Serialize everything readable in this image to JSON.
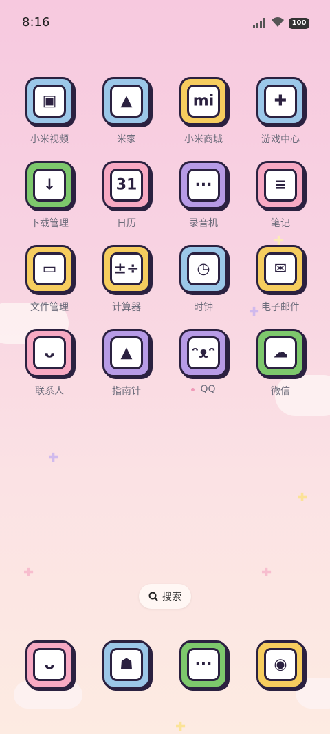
{
  "status_bar": {
    "time": "8:16",
    "battery": "100"
  },
  "apps": [
    {
      "label": "小米视频",
      "name": "app-xiaomi-video",
      "color": "#9bc7e8",
      "glyph": "▣"
    },
    {
      "label": "米家",
      "name": "app-mijia",
      "color": "#9bc7e8",
      "glyph": "▲"
    },
    {
      "label": "小米商城",
      "name": "app-xiaomi-mall",
      "color": "#f6cd5e",
      "glyph": "mi"
    },
    {
      "label": "游戏中心",
      "name": "app-game-center",
      "color": "#9bc7e8",
      "glyph": "✚"
    },
    {
      "label": "下载管理",
      "name": "app-downloads",
      "color": "#7dc86c",
      "glyph": "↓"
    },
    {
      "label": "日历",
      "name": "app-calendar",
      "color": "#f7a9c3",
      "glyph": "31"
    },
    {
      "label": "录音机",
      "name": "app-recorder",
      "color": "#b79be6",
      "glyph": "···"
    },
    {
      "label": "笔记",
      "name": "app-notes",
      "color": "#f7a9c3",
      "glyph": "≡"
    },
    {
      "label": "文件管理",
      "name": "app-file-manager",
      "color": "#f6cd5e",
      "glyph": "▭"
    },
    {
      "label": "计算器",
      "name": "app-calculator",
      "color": "#f6cd5e",
      "glyph": "±÷"
    },
    {
      "label": "时钟",
      "name": "app-clock",
      "color": "#9bc7e8",
      "glyph": "◷"
    },
    {
      "label": "电子邮件",
      "name": "app-email",
      "color": "#f6cd5e",
      "glyph": "✉"
    },
    {
      "label": "联系人",
      "name": "app-contacts",
      "color": "#f7a9c3",
      "glyph": "ᴗ"
    },
    {
      "label": "指南针",
      "name": "app-compass",
      "color": "#b79be6",
      "glyph": "▲"
    },
    {
      "label": "QQ",
      "name": "app-qq",
      "color": "#b79be6",
      "glyph": "ᵔᴥᵔ",
      "dot": true
    },
    {
      "label": "微信",
      "name": "app-wechat",
      "color": "#7dc86c",
      "glyph": "☁"
    }
  ],
  "search": {
    "label": "搜索"
  },
  "dock": [
    {
      "name": "dock-phone",
      "color": "#f7a9c3",
      "glyph": "ᴗ"
    },
    {
      "name": "dock-messages",
      "color": "#9bc7e8",
      "glyph": "☗"
    },
    {
      "name": "dock-chat",
      "color": "#7dc86c",
      "glyph": "···"
    },
    {
      "name": "dock-camera",
      "color": "#f6cd5e",
      "glyph": "◉"
    }
  ]
}
